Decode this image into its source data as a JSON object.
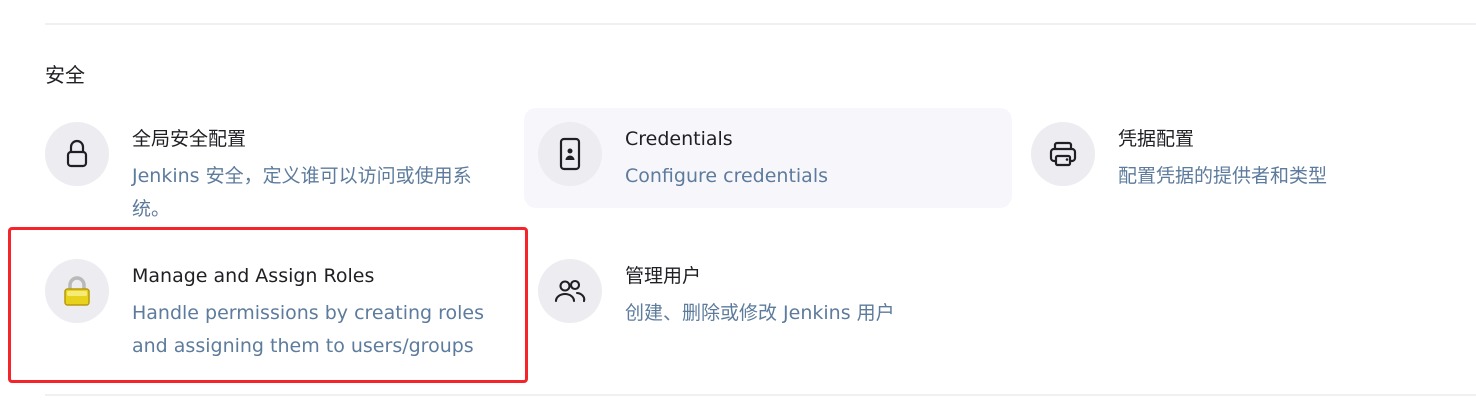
{
  "section": {
    "title": "安全"
  },
  "items": [
    {
      "title": "全局安全配置",
      "description": "Jenkins 安全，定义谁可以访问或使用系统。",
      "icon": "lock-icon"
    },
    {
      "title": "Credentials",
      "description": "Configure credentials",
      "icon": "credentials-device-icon"
    },
    {
      "title": "凭据配置",
      "description": "配置凭据的提供者和类型",
      "icon": "credential-providers-icon"
    },
    {
      "title": "Manage and Assign Roles",
      "description": "Handle permissions by creating roles and assigning them to users/groups",
      "icon": "yellow-padlock-icon"
    },
    {
      "title": "管理用户",
      "description": "创建、删除或修改 Jenkins 用户",
      "icon": "users-icon"
    }
  ],
  "colors": {
    "title": "#1f1f24",
    "description": "#5d7b9c",
    "icon_bg": "#ececf1",
    "hover_bg": "#f7f7fb",
    "highlight_border": "#f5242a"
  }
}
